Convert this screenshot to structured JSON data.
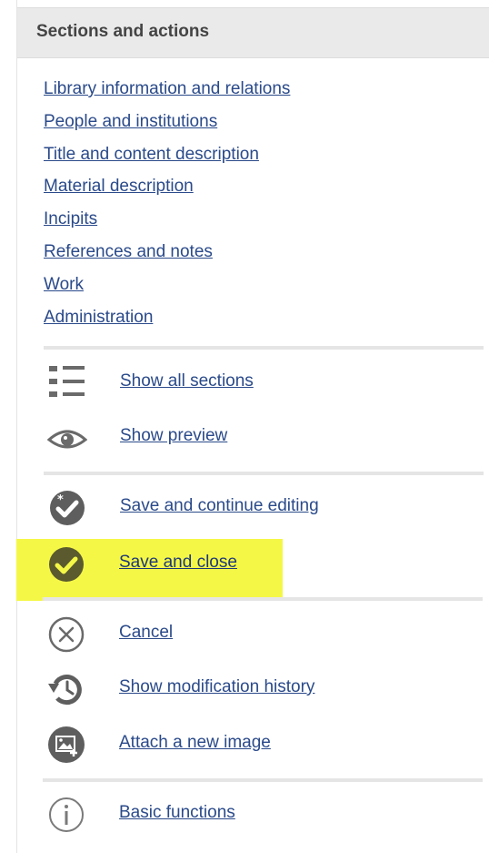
{
  "panel": {
    "title": "Sections and actions"
  },
  "sections": [
    "Library information and relations",
    "People and institutions",
    "Title and content description",
    "Material description",
    "Incipits",
    "References and notes",
    "Work",
    "Administration"
  ],
  "actions": {
    "show_all_sections": {
      "label": "Show all sections",
      "icon": "list-icon"
    },
    "show_preview": {
      "label": "Show preview",
      "icon": "eye-icon"
    },
    "save_continue": {
      "label": "Save and continue editing",
      "icon": "save-continue-icon"
    },
    "save_close": {
      "label": "Save and close",
      "icon": "check-circle-icon"
    },
    "cancel": {
      "label": "Cancel",
      "icon": "cancel-circle-icon"
    },
    "history": {
      "label": "Show modification history",
      "icon": "history-icon"
    },
    "attach_image": {
      "label": "Attach a new image",
      "icon": "image-add-icon"
    },
    "basic_functions": {
      "label": "Basic functions",
      "icon": "info-icon"
    }
  },
  "colors": {
    "link": "#2a4a8a",
    "icon": "#666666",
    "highlight": "#f5f747",
    "header_bg": "#eaeaea"
  }
}
